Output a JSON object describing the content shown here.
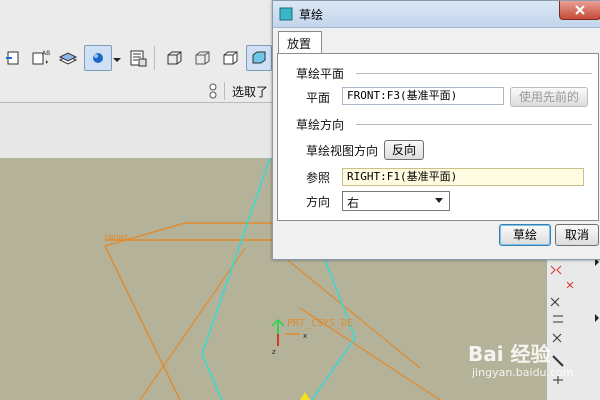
{
  "toolbar": {
    "select_label": "选取了"
  },
  "viewport": {
    "csys_label": "PRT_CSYS_DE",
    "axis_x": "x",
    "axis_z": "z",
    "datum_label": "FRONT"
  },
  "dialog": {
    "title": "草绘",
    "tab": "放置",
    "section_plane": "草绘平面",
    "plane_label": "平面",
    "plane_value": "FRONT:F3(基准平面)",
    "use_previous": "使用先前的",
    "section_orientation": "草绘方向",
    "view_direction_label": "草绘视图方向",
    "flip_button": "反向",
    "reference_label": "参照",
    "reference_value": "RIGHT:F1(基准平面)",
    "orientation_label": "方向",
    "orientation_value": "右",
    "ok_button": "草绘",
    "cancel_button": "取消"
  },
  "watermark": {
    "brand": "Bai 经验",
    "url": "jingyan.baidu.com"
  },
  "colors": {
    "viewport_bg": "#b5b29a",
    "datum_orange": "#e08a2c",
    "sketch_cyan": "#3fd6d0",
    "field_highlight": "#fffbe0"
  }
}
